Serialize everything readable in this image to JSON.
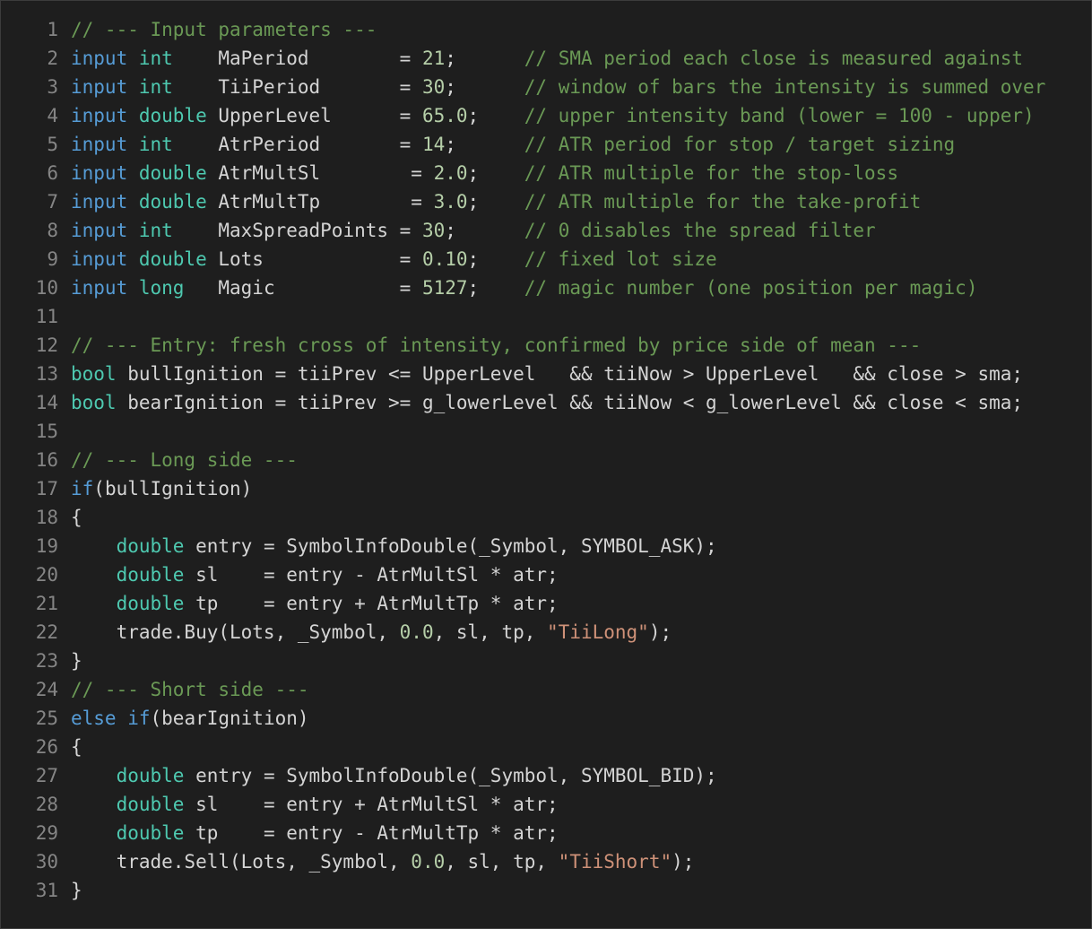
{
  "colors": {
    "background": "#1e1e1e",
    "default_text": "#d4d4d4",
    "line_number": "#858585",
    "keyword": "#569cd6",
    "type": "#4ec9b0",
    "comment": "#6a9955",
    "number": "#b5cea8",
    "string": "#ce9178"
  },
  "lines": [
    {
      "n": "1",
      "tokens": [
        {
          "t": "// --- Input parameters ---",
          "c": "cm"
        }
      ]
    },
    {
      "n": "2",
      "tokens": [
        {
          "t": "input ",
          "c": "kw"
        },
        {
          "t": "int",
          "c": "ty"
        },
        {
          "t": "    MaPeriod        = ",
          "c": ""
        },
        {
          "t": "21",
          "c": "num"
        },
        {
          "t": ";      ",
          "c": ""
        },
        {
          "t": "// SMA period each close is measured against",
          "c": "cm"
        }
      ]
    },
    {
      "n": "3",
      "tokens": [
        {
          "t": "input ",
          "c": "kw"
        },
        {
          "t": "int",
          "c": "ty"
        },
        {
          "t": "    TiiPeriod       = ",
          "c": ""
        },
        {
          "t": "30",
          "c": "num"
        },
        {
          "t": ";      ",
          "c": ""
        },
        {
          "t": "// window of bars the intensity is summed over",
          "c": "cm"
        }
      ]
    },
    {
      "n": "4",
      "tokens": [
        {
          "t": "input ",
          "c": "kw"
        },
        {
          "t": "double",
          "c": "ty"
        },
        {
          "t": " UpperLevel      = ",
          "c": ""
        },
        {
          "t": "65.0",
          "c": "num"
        },
        {
          "t": ";    ",
          "c": ""
        },
        {
          "t": "// upper intensity band (lower = 100 - upper)",
          "c": "cm"
        }
      ]
    },
    {
      "n": "5",
      "tokens": [
        {
          "t": "input ",
          "c": "kw"
        },
        {
          "t": "int",
          "c": "ty"
        },
        {
          "t": "    AtrPeriod       = ",
          "c": ""
        },
        {
          "t": "14",
          "c": "num"
        },
        {
          "t": ";      ",
          "c": ""
        },
        {
          "t": "// ATR period for stop / target sizing",
          "c": "cm"
        }
      ]
    },
    {
      "n": "6",
      "tokens": [
        {
          "t": "input ",
          "c": "kw"
        },
        {
          "t": "double",
          "c": "ty"
        },
        {
          "t": " AtrMultSl        = ",
          "c": ""
        },
        {
          "t": "2.0",
          "c": "num"
        },
        {
          "t": ";    ",
          "c": ""
        },
        {
          "t": "// ATR multiple for the stop-loss",
          "c": "cm"
        }
      ]
    },
    {
      "n": "7",
      "tokens": [
        {
          "t": "input ",
          "c": "kw"
        },
        {
          "t": "double",
          "c": "ty"
        },
        {
          "t": " AtrMultTp        = ",
          "c": ""
        },
        {
          "t": "3.0",
          "c": "num"
        },
        {
          "t": ";    ",
          "c": ""
        },
        {
          "t": "// ATR multiple for the take-profit",
          "c": "cm"
        }
      ]
    },
    {
      "n": "8",
      "tokens": [
        {
          "t": "input ",
          "c": "kw"
        },
        {
          "t": "int",
          "c": "ty"
        },
        {
          "t": "    MaxSpreadPoints = ",
          "c": ""
        },
        {
          "t": "30",
          "c": "num"
        },
        {
          "t": ";      ",
          "c": ""
        },
        {
          "t": "// 0 disables the spread filter",
          "c": "cm"
        }
      ]
    },
    {
      "n": "9",
      "tokens": [
        {
          "t": "input ",
          "c": "kw"
        },
        {
          "t": "double",
          "c": "ty"
        },
        {
          "t": " Lots            = ",
          "c": ""
        },
        {
          "t": "0.10",
          "c": "num"
        },
        {
          "t": ";    ",
          "c": ""
        },
        {
          "t": "// fixed lot size",
          "c": "cm"
        }
      ]
    },
    {
      "n": "10",
      "tokens": [
        {
          "t": "input ",
          "c": "kw"
        },
        {
          "t": "long",
          "c": "ty"
        },
        {
          "t": "   Magic           = ",
          "c": ""
        },
        {
          "t": "5127",
          "c": "num"
        },
        {
          "t": ";    ",
          "c": ""
        },
        {
          "t": "// magic number (one position per magic)",
          "c": "cm"
        }
      ]
    },
    {
      "n": "11",
      "tokens": []
    },
    {
      "n": "12",
      "tokens": [
        {
          "t": "// --- Entry: fresh cross of intensity, confirmed by price side of mean ---",
          "c": "cm"
        }
      ]
    },
    {
      "n": "13",
      "tokens": [
        {
          "t": "bool",
          "c": "ty"
        },
        {
          "t": " bullIgnition = tiiPrev <= UpperLevel   && tiiNow > UpperLevel   && close > sma;",
          "c": ""
        }
      ]
    },
    {
      "n": "14",
      "tokens": [
        {
          "t": "bool",
          "c": "ty"
        },
        {
          "t": " bearIgnition = tiiPrev >= g_lowerLevel && tiiNow < g_lowerLevel && close < sma;",
          "c": ""
        }
      ]
    },
    {
      "n": "15",
      "tokens": []
    },
    {
      "n": "16",
      "tokens": [
        {
          "t": "// --- Long side ---",
          "c": "cm"
        }
      ]
    },
    {
      "n": "17",
      "tokens": [
        {
          "t": "if",
          "c": "kw"
        },
        {
          "t": "(bullIgnition)",
          "c": ""
        }
      ]
    },
    {
      "n": "18",
      "tokens": [
        {
          "t": "{",
          "c": ""
        }
      ]
    },
    {
      "n": "19",
      "tokens": [
        {
          "t": "    ",
          "c": ""
        },
        {
          "t": "double",
          "c": "ty"
        },
        {
          "t": " entry = SymbolInfoDouble(_Symbol, SYMBOL_ASK);",
          "c": ""
        }
      ]
    },
    {
      "n": "20",
      "tokens": [
        {
          "t": "    ",
          "c": ""
        },
        {
          "t": "double",
          "c": "ty"
        },
        {
          "t": " sl    = entry - AtrMultSl * atr;",
          "c": ""
        }
      ]
    },
    {
      "n": "21",
      "tokens": [
        {
          "t": "    ",
          "c": ""
        },
        {
          "t": "double",
          "c": "ty"
        },
        {
          "t": " tp    = entry + AtrMultTp * atr;",
          "c": ""
        }
      ]
    },
    {
      "n": "22",
      "tokens": [
        {
          "t": "    trade.Buy(Lots, _Symbol, ",
          "c": ""
        },
        {
          "t": "0.0",
          "c": "num"
        },
        {
          "t": ", sl, tp, ",
          "c": ""
        },
        {
          "t": "\"TiiLong\"",
          "c": "str"
        },
        {
          "t": ");",
          "c": ""
        }
      ]
    },
    {
      "n": "23",
      "tokens": [
        {
          "t": "}",
          "c": ""
        }
      ]
    },
    {
      "n": "24",
      "tokens": [
        {
          "t": "// --- Short side ---",
          "c": "cm"
        }
      ]
    },
    {
      "n": "25",
      "tokens": [
        {
          "t": "else if",
          "c": "kw"
        },
        {
          "t": "(bearIgnition)",
          "c": ""
        }
      ]
    },
    {
      "n": "26",
      "tokens": [
        {
          "t": "{",
          "c": ""
        }
      ]
    },
    {
      "n": "27",
      "tokens": [
        {
          "t": "    ",
          "c": ""
        },
        {
          "t": "double",
          "c": "ty"
        },
        {
          "t": " entry = SymbolInfoDouble(_Symbol, SYMBOL_BID);",
          "c": ""
        }
      ]
    },
    {
      "n": "28",
      "tokens": [
        {
          "t": "    ",
          "c": ""
        },
        {
          "t": "double",
          "c": "ty"
        },
        {
          "t": " sl    = entry + AtrMultSl * atr;",
          "c": ""
        }
      ]
    },
    {
      "n": "29",
      "tokens": [
        {
          "t": "    ",
          "c": ""
        },
        {
          "t": "double",
          "c": "ty"
        },
        {
          "t": " tp    = entry - AtrMultTp * atr;",
          "c": ""
        }
      ]
    },
    {
      "n": "30",
      "tokens": [
        {
          "t": "    trade.Sell(Lots, _Symbol, ",
          "c": ""
        },
        {
          "t": "0.0",
          "c": "num"
        },
        {
          "t": ", sl, tp, ",
          "c": ""
        },
        {
          "t": "\"TiiShort\"",
          "c": "str"
        },
        {
          "t": ");",
          "c": ""
        }
      ]
    },
    {
      "n": "31",
      "tokens": [
        {
          "t": "}",
          "c": ""
        }
      ]
    }
  ]
}
